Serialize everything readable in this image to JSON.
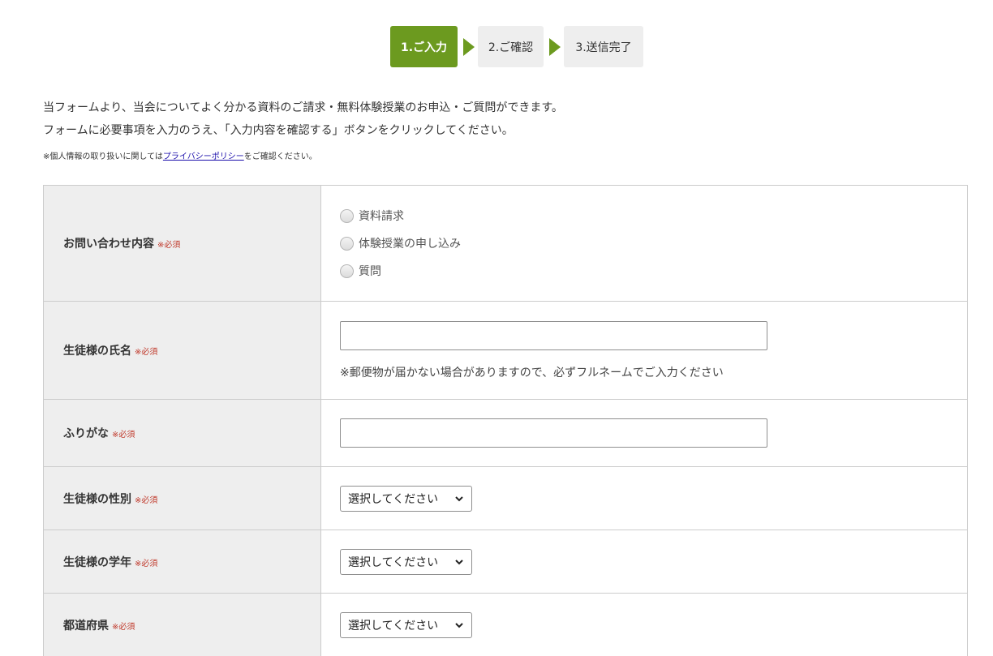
{
  "steps": [
    {
      "label": "1.ご入力"
    },
    {
      "label": "2.ご確認"
    },
    {
      "label": "3.送信完了"
    }
  ],
  "intro": {
    "line1": "当フォームより、当会についてよく分かる資料のご請求・無料体験授業のお申込・ご質問ができます。",
    "line2": "フォームに必要事項を入力のうえ、「入力内容を確認する」ボタンをクリックしてください。",
    "note_prefix": "※個人情報の取り扱いに関しては",
    "note_link": "プライバシーポリシー",
    "note_suffix": "をご確認ください。"
  },
  "required_mark": "※必須",
  "form": {
    "inquiry": {
      "label": "お問い合わせ内容",
      "options": [
        "資料請求",
        "体験授業の申し込み",
        "質問"
      ]
    },
    "student_name": {
      "label": "生徒様の氏名",
      "value": "",
      "note": "※郵便物が届かない場合がありますので、必ずフルネームでご入力ください"
    },
    "furigana": {
      "label": "ふりがな",
      "value": ""
    },
    "gender": {
      "label": "生徒様の性別",
      "selected": "選択してください"
    },
    "grade": {
      "label": "生徒様の学年",
      "selected": "選択してください"
    },
    "prefecture": {
      "label": "都道府県",
      "selected": "選択してください"
    }
  },
  "colors": {
    "accent": "#6c9a1f",
    "required": "#c0392b",
    "label_bg": "#eeeeee",
    "link": "#1a0dab"
  }
}
